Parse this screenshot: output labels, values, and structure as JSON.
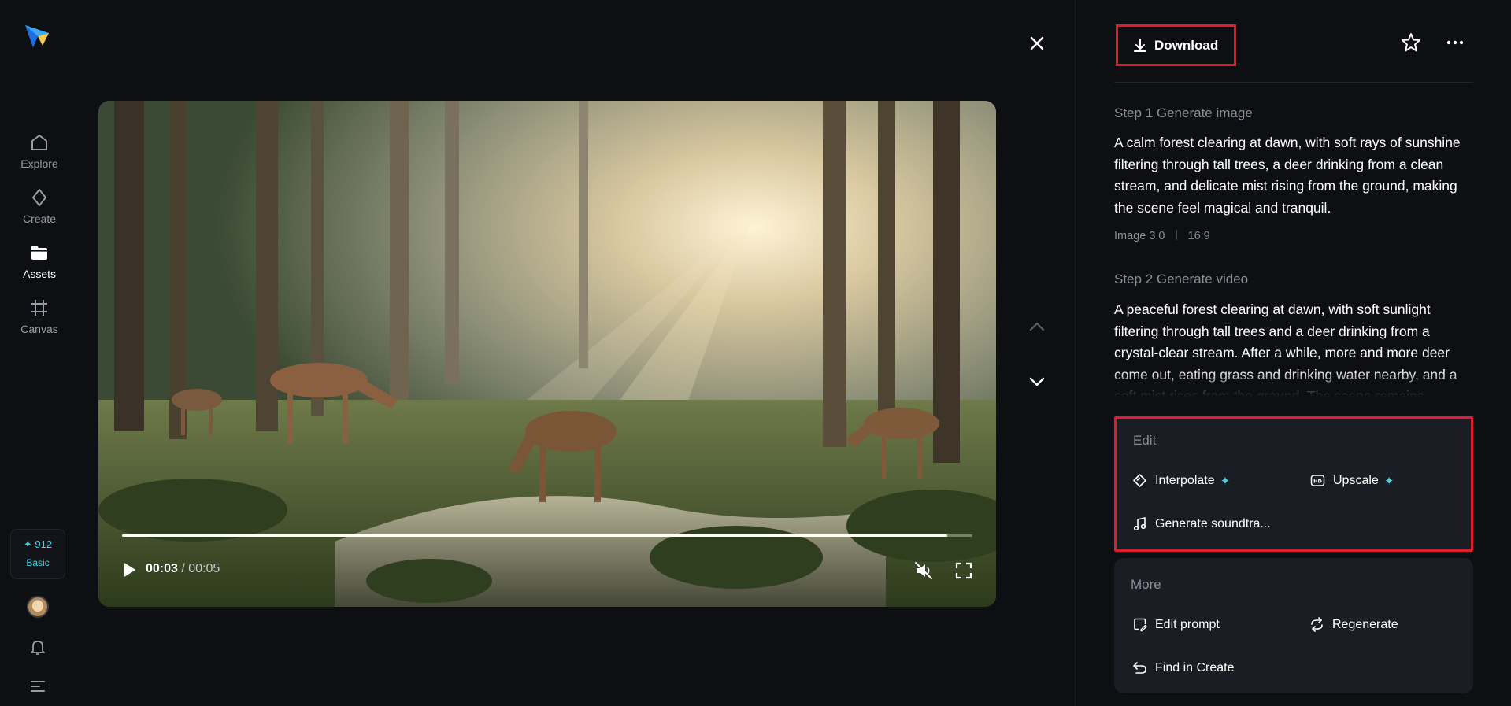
{
  "nav": {
    "items": [
      {
        "label": "Explore",
        "icon": "home-icon"
      },
      {
        "label": "Create",
        "icon": "sparkle-diamond-icon"
      },
      {
        "label": "Assets",
        "icon": "folder-icon"
      },
      {
        "label": "Canvas",
        "icon": "frame-icon"
      }
    ],
    "credits": "✦ 912",
    "plan": "Basic"
  },
  "player": {
    "current_time": "00:03",
    "separator": " / ",
    "duration": "00:05",
    "progress": 0.97
  },
  "panel": {
    "download_label": "Download",
    "step1_title": "Step 1 Generate image",
    "step1_prompt": "A calm forest clearing at dawn, with soft rays of sunshine filtering through tall trees, a deer drinking from a clean stream, and delicate mist rising from the ground, making the scene feel magical and tranquil.",
    "model": "Image 3.0",
    "ratio": "16:9",
    "step2_title": "Step 2 Generate video",
    "step2_prompt": "A peaceful forest clearing at dawn, with soft sunlight filtering through tall trees and a deer drinking from a crystal-clear stream. After a while, more and more deer come out, eating grass and drinking water nearby, and a soft mist rises from the ground. The scene remains"
  },
  "edit": {
    "title": "Edit",
    "interpolate": "Interpolate",
    "upscale": "Upscale",
    "soundtrack": "Generate soundtra...",
    "sparkle": "✦"
  },
  "more": {
    "title": "More",
    "edit_prompt": "Edit prompt",
    "regenerate": "Regenerate",
    "find_in_create": "Find in Create"
  },
  "colors": {
    "accent": "#3fd8e6",
    "highlight": "#e01d2d",
    "background": "#0e0f13",
    "card": "#1b1d24"
  }
}
